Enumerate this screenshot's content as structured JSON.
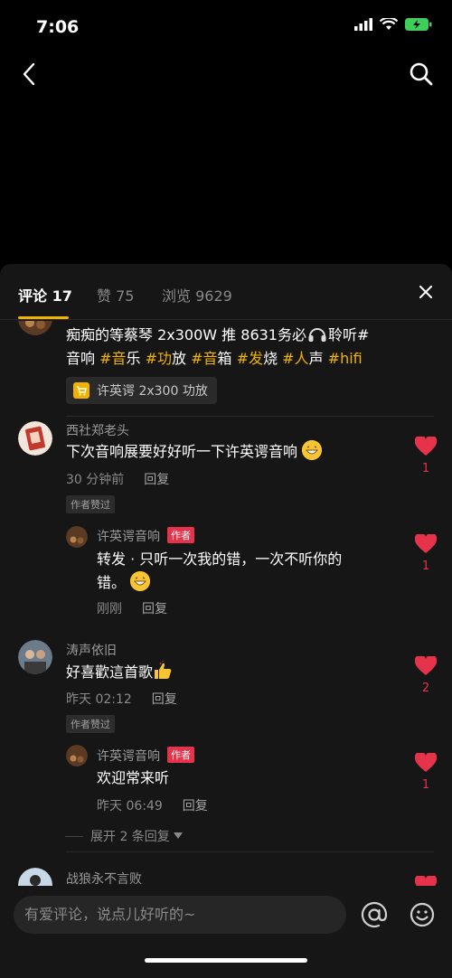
{
  "status": {
    "time": "7:06"
  },
  "tabs": [
    {
      "label": "评论 17"
    },
    {
      "label": "赞 75"
    },
    {
      "label": "浏览 9629"
    }
  ],
  "post": {
    "text_plain_1": "痴痴的等蔡琴 2x300W 推 8631务必",
    "text_plain_2": "聆听#",
    "tags_line": [
      {
        "text": "音响 ",
        "type": "plain"
      },
      {
        "text": "#音",
        "type": "tag"
      },
      {
        "text": "乐 ",
        "type": "plain"
      },
      {
        "text": "#功",
        "type": "tag"
      },
      {
        "text": "放 ",
        "type": "plain"
      },
      {
        "text": "#音",
        "type": "tag"
      },
      {
        "text": "箱 ",
        "type": "plain"
      },
      {
        "text": "#发",
        "type": "tag"
      },
      {
        "text": "烧 ",
        "type": "plain"
      },
      {
        "text": "#人",
        "type": "tag"
      },
      {
        "text": "声 ",
        "type": "plain"
      },
      {
        "text": "#hifi",
        "type": "tag"
      }
    ],
    "product_chip": "许英谔 2x300 功放"
  },
  "comments": [
    {
      "name": "西社郑老头",
      "text": "下次音响展要好好听一下许英谔音响",
      "time": "30 分钟前",
      "reply_label": "回复",
      "liked_badge": "作者赞过",
      "like_count": "1",
      "reply": {
        "name": "许英谔音响",
        "author_badge": "作者",
        "text_line1": "转发 · 只听一次我的错，一次不听你的",
        "text_line2": "错。",
        "time": "刚刚",
        "reply_label": "回复",
        "like_count": "1"
      }
    },
    {
      "name": "涛声依旧",
      "text": "好喜歡這首歌",
      "time": "昨天 02:12",
      "reply_label": "回复",
      "liked_badge": "作者赞过",
      "like_count": "2",
      "reply": {
        "name": "许英谔音响",
        "author_badge": "作者",
        "text_line1": "欢迎常来听",
        "time": "昨天 06:49",
        "reply_label": "回复",
        "like_count": "1"
      },
      "expand_label": "展开 2 条回复"
    },
    {
      "name": "战狼永不言败"
    }
  ],
  "input": {
    "placeholder": "有爱评论，说点儿好听的~"
  },
  "colors": {
    "accent": "#f0b400",
    "like": "#e5334b",
    "sheet": "#161616"
  },
  "icons": [
    "back-icon",
    "search-icon",
    "close-icon",
    "heart-icon",
    "cart-icon",
    "at-icon",
    "emoji-icon"
  ]
}
